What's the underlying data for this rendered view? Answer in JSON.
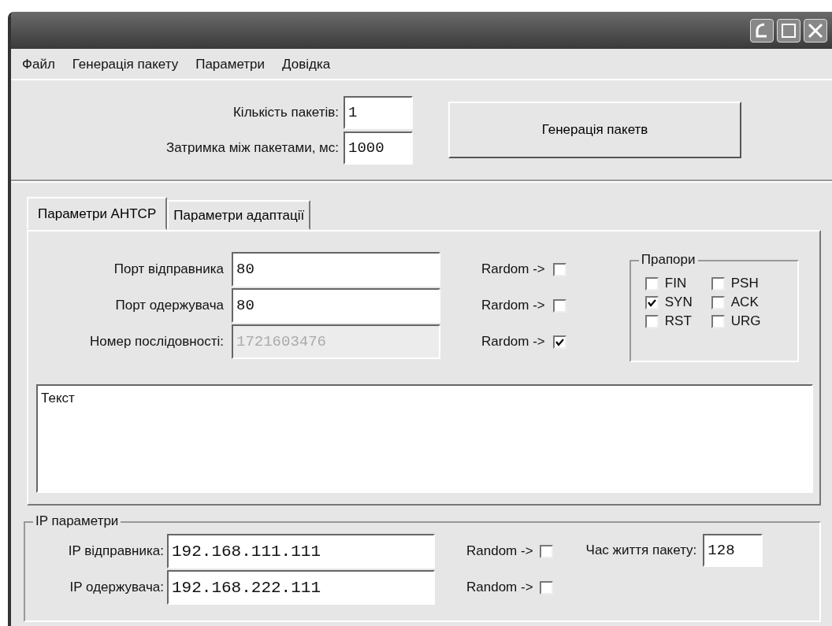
{
  "menu": [
    {
      "label": "Файл"
    },
    {
      "label": "Генерація пакету"
    },
    {
      "label": "Параметри"
    },
    {
      "label": "Довідка"
    }
  ],
  "packet": {
    "count_label": "Кількість пакетів:",
    "count_value": "1",
    "delay_label": "Затримка між пакетами, мс:",
    "delay_value": "1000",
    "generate_button": "Генерація пакетв"
  },
  "tabs": [
    {
      "label": "Параметри AHTCP",
      "selected": true
    },
    {
      "label": "Параметри адаптації",
      "selected": false
    }
  ],
  "tcp": {
    "rows": [
      {
        "label": "Порт відправника",
        "value": "80",
        "disabled": false,
        "random_label": "Rardom ->",
        "random_checked": false
      },
      {
        "label": "Порт одержувача",
        "value": "80",
        "disabled": false,
        "random_label": "Rardom ->",
        "random_checked": false
      },
      {
        "label": "Номер послідовності:",
        "value": "1721603476",
        "disabled": true,
        "random_label": "Rardom ->",
        "random_checked": true
      }
    ],
    "flags": {
      "title": "Прапори",
      "items": [
        {
          "label": "FIN",
          "checked": false
        },
        {
          "label": "PSH",
          "checked": false
        },
        {
          "label": "SYN",
          "checked": true
        },
        {
          "label": "ACK",
          "checked": false
        },
        {
          "label": "RST",
          "checked": false
        },
        {
          "label": "URG",
          "checked": false
        }
      ]
    },
    "text": "Текст"
  },
  "ip": {
    "title": "IP параметри",
    "rows": [
      {
        "label": "IP відправника:",
        "value": "192.168.111.111",
        "random_label": "Random ->",
        "random_checked": false
      },
      {
        "label": "IP одержувача:",
        "value": "192.168.222.111",
        "random_label": "Random ->",
        "random_checked": false
      }
    ],
    "ttl_label": "Час життя пакету:",
    "ttl_value": "128"
  }
}
